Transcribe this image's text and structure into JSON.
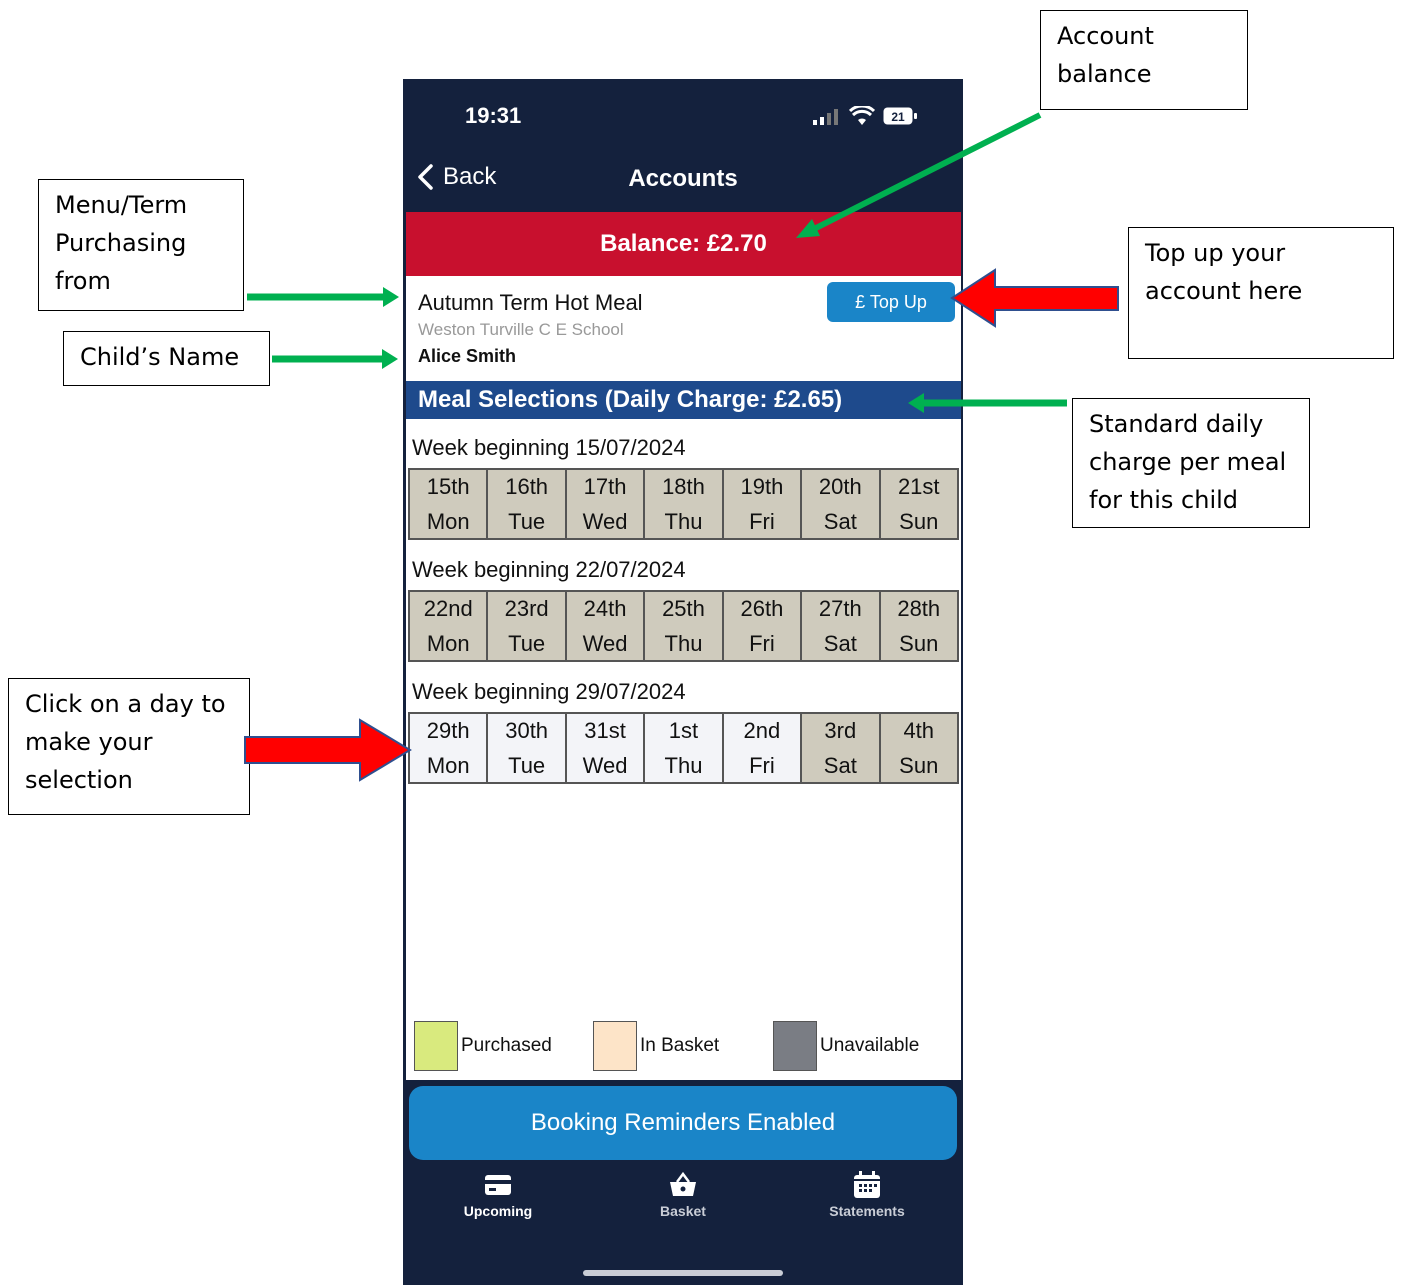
{
  "status_bar": {
    "time": "19:31",
    "battery": "21"
  },
  "nav": {
    "back_label": "Back",
    "title": "Accounts"
  },
  "balance_label": "Balance: £2.70",
  "account": {
    "name": "Autumn Term Hot Meal",
    "school": "Weston Turville C E School",
    "child": "Alice Smith",
    "topup_label": "£ Top Up"
  },
  "meal_header": "Meal Selections (Daily Charge: £2.65)",
  "weeks": [
    {
      "label": "Week beginning 15/07/2024",
      "days": [
        {
          "date": "15th",
          "dow": "Mon",
          "state": "unavailable"
        },
        {
          "date": "16th",
          "dow": "Tue",
          "state": "unavailable"
        },
        {
          "date": "17th",
          "dow": "Wed",
          "state": "unavailable"
        },
        {
          "date": "18th",
          "dow": "Thu",
          "state": "unavailable"
        },
        {
          "date": "19th",
          "dow": "Fri",
          "state": "unavailable"
        },
        {
          "date": "20th",
          "dow": "Sat",
          "state": "unavailable"
        },
        {
          "date": "21st",
          "dow": "Sun",
          "state": "unavailable"
        }
      ]
    },
    {
      "label": "Week beginning 22/07/2024",
      "days": [
        {
          "date": "22nd",
          "dow": "Mon",
          "state": "unavailable"
        },
        {
          "date": "23rd",
          "dow": "Tue",
          "state": "unavailable"
        },
        {
          "date": "24th",
          "dow": "Wed",
          "state": "unavailable"
        },
        {
          "date": "25th",
          "dow": "Thu",
          "state": "unavailable"
        },
        {
          "date": "26th",
          "dow": "Fri",
          "state": "unavailable"
        },
        {
          "date": "27th",
          "dow": "Sat",
          "state": "unavailable"
        },
        {
          "date": "28th",
          "dow": "Sun",
          "state": "unavailable"
        }
      ]
    },
    {
      "label": "Week beginning 29/07/2024",
      "days": [
        {
          "date": "29th",
          "dow": "Mon",
          "state": "available"
        },
        {
          "date": "30th",
          "dow": "Tue",
          "state": "available"
        },
        {
          "date": "31st",
          "dow": "Wed",
          "state": "available"
        },
        {
          "date": "1st",
          "dow": "Thu",
          "state": "available"
        },
        {
          "date": "2nd",
          "dow": "Fri",
          "state": "available"
        },
        {
          "date": "3rd",
          "dow": "Sat",
          "state": "unavailable"
        },
        {
          "date": "4th",
          "dow": "Sun",
          "state": "unavailable"
        }
      ]
    }
  ],
  "legend": {
    "purchased": "Purchased",
    "in_basket": "In Basket",
    "unavailable": "Unavailable",
    "colors": {
      "purchased": "#d9ea7e",
      "in_basket": "#fde4c8",
      "unavailable": "#7a7d84"
    }
  },
  "reminders_label": "Booking Reminders Enabled",
  "tabs": [
    {
      "label": "Upcoming",
      "icon": "card-icon"
    },
    {
      "label": "Basket",
      "icon": "basket-icon"
    },
    {
      "label": "Statements",
      "icon": "calendar-icon"
    }
  ],
  "annotations": {
    "account_balance": "Account balance",
    "menu_term": "Menu/Term Purchasing from",
    "childs_name": "Child’s Name",
    "top_up": "Top up your account here",
    "daily_charge": "Standard daily charge per meal for this child",
    "click_day": "Click on a day to make your selection"
  },
  "colors": {
    "navy": "#14213d",
    "balance_red": "#c8102e",
    "header_blue": "#1e4a8c",
    "button_blue": "#1a85c8",
    "arrow_green": "#00b050",
    "arrow_red": "#ff0000"
  }
}
